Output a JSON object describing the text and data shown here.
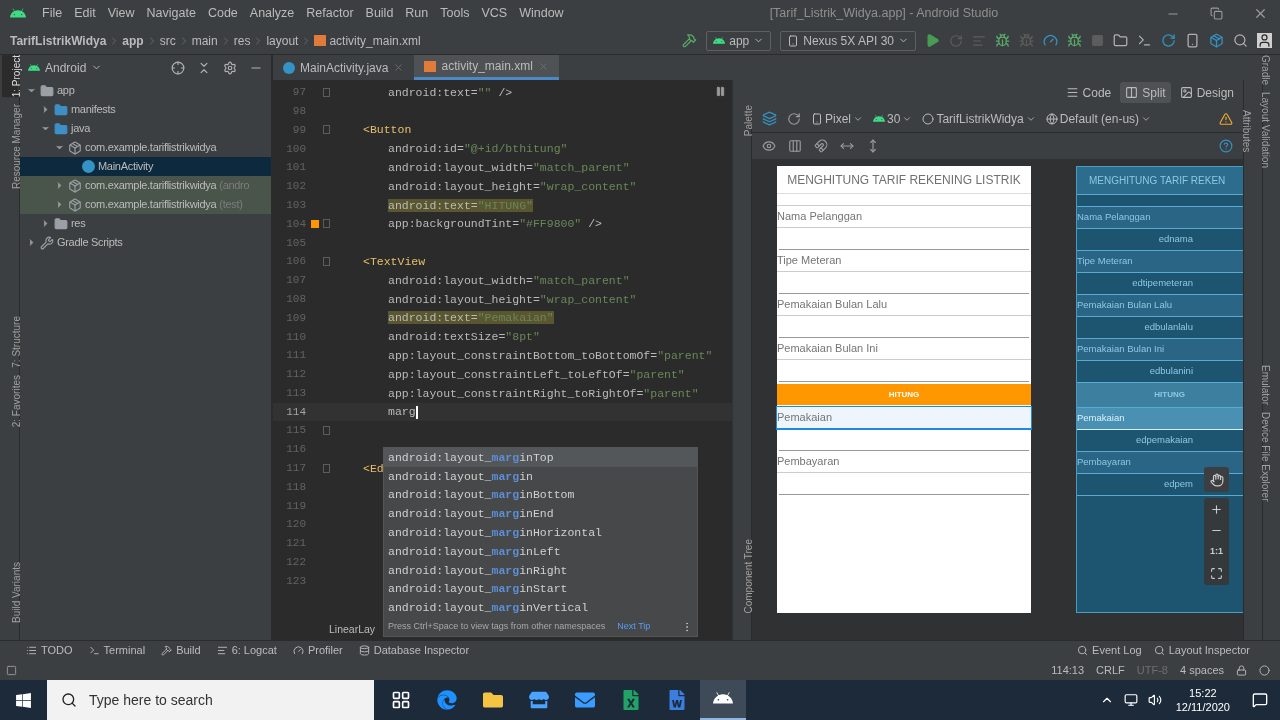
{
  "menu_bar": {
    "items": [
      "File",
      "Edit",
      "View",
      "Navigate",
      "Code",
      "Analyze",
      "Refactor",
      "Build",
      "Run",
      "Tools",
      "VCS",
      "Window"
    ],
    "title": "[Tarif_Listrik_Widya.app] - Android Studio"
  },
  "navigation_bar": {
    "breadcrumb": [
      "TarifListrikWidya",
      "app",
      "src",
      "main",
      "res",
      "layout",
      "activity_main.xml"
    ],
    "run_config": "app",
    "device": "Nexus 5X API 30"
  },
  "left_stripe": [
    {
      "label": "1: Project",
      "selected": true
    },
    {
      "label": "Resource Manager",
      "selected": false
    },
    {
      "label": "7: Structure",
      "selected": false
    },
    {
      "label": "2: Favorites",
      "selected": false
    },
    {
      "label": "Build Variants",
      "selected": false
    }
  ],
  "project_panel": {
    "view": "Android",
    "tree": [
      {
        "label": "app",
        "kind": "module",
        "expanded": true,
        "selected": false,
        "test": false,
        "children": [
          {
            "label": "manifests",
            "kind": "folder",
            "expanded": false,
            "selected": false,
            "test": false
          },
          {
            "label": "java",
            "kind": "folder",
            "expanded": true,
            "selected": false,
            "test": false,
            "children": [
              {
                "label": "com.example.tariflistrikwidya",
                "kind": "package",
                "expanded": true,
                "selected": false,
                "test": false,
                "children": [
                  {
                    "label": "MainActivity",
                    "kind": "class",
                    "expanded": false,
                    "selected": true,
                    "test": false
                  }
                ]
              },
              {
                "label": "com.example.tariflistrikwidya",
                "suffix": "(andro",
                "kind": "package",
                "expanded": false,
                "selected": false,
                "test": true
              },
              {
                "label": "com.example.tariflistrikwidya",
                "suffix": "(test)",
                "kind": "package",
                "expanded": false,
                "selected": false,
                "test": true
              }
            ]
          },
          {
            "label": "res",
            "kind": "resources",
            "expanded": false,
            "selected": false,
            "test": false
          }
        ]
      },
      {
        "label": "Gradle Scripts",
        "kind": "gradle",
        "expanded": false,
        "selected": false,
        "test": false
      }
    ]
  },
  "editor": {
    "tabs": [
      {
        "label": "MainActivity.java",
        "kind": "java",
        "selected": false
      },
      {
        "label": "activity_main.xml",
        "kind": "xml",
        "selected": true
      }
    ],
    "lines": [
      {
        "number": "97",
        "kind": "attr",
        "fold": true,
        "current": false,
        "highlighted": false,
        "segments": [
          {
            "text": "android:text=",
            "kind": "attr"
          },
          {
            "text": "\"\"",
            "kind": "value"
          },
          {
            "text": " />",
            "kind": "plain"
          }
        ]
      },
      {
        "number": "98",
        "kind": "blank",
        "fold": false,
        "current": false
      },
      {
        "number": "99",
        "kind": "tag",
        "fold": true,
        "current": false,
        "highlighted": false,
        "segments": [
          {
            "text": "<Button",
            "kind": "tag"
          }
        ]
      },
      {
        "number": "100",
        "kind": "attr",
        "fold": false,
        "current": false,
        "highlighted": false,
        "segments": [
          {
            "text": "android:id=",
            "kind": "attr"
          },
          {
            "text": "\"@+id/bthitung\"",
            "kind": "value"
          }
        ]
      },
      {
        "number": "101",
        "kind": "attr",
        "fold": false,
        "current": false,
        "highlighted": false,
        "segments": [
          {
            "text": "android:layout_width=",
            "kind": "attr"
          },
          {
            "text": "\"match_parent\"",
            "kind": "value"
          }
        ]
      },
      {
        "number": "102",
        "kind": "attr",
        "fold": false,
        "current": false,
        "highlighted": false,
        "segments": [
          {
            "text": "android:layout_height=",
            "kind": "attr"
          },
          {
            "text": "\"wrap_content\"",
            "kind": "value"
          }
        ]
      },
      {
        "number": "103",
        "kind": "attr",
        "fold": false,
        "current": false,
        "highlighted": true,
        "segments": [
          {
            "text": "android:text=",
            "kind": "attr"
          },
          {
            "text": "\"HITUNG\"",
            "kind": "value"
          }
        ]
      },
      {
        "number": "104",
        "kind": "attr",
        "fold": true,
        "current": false,
        "highlighted": false,
        "color": "#ff9800",
        "segments": [
          {
            "text": "app:backgroundTint=",
            "kind": "attr"
          },
          {
            "text": "\"#FF9800\"",
            "kind": "value"
          },
          {
            "text": " />",
            "kind": "plain"
          }
        ]
      },
      {
        "number": "105",
        "kind": "blank",
        "fold": false,
        "current": false
      },
      {
        "number": "106",
        "kind": "tag",
        "fold": true,
        "current": false,
        "highlighted": false,
        "segments": [
          {
            "text": "<TextView",
            "kind": "tag"
          }
        ]
      },
      {
        "number": "107",
        "kind": "attr",
        "fold": false,
        "current": false,
        "highlighted": false,
        "segments": [
          {
            "text": "android:layout_width=",
            "kind": "attr"
          },
          {
            "text": "\"match_parent\"",
            "kind": "value"
          }
        ]
      },
      {
        "number": "108",
        "kind": "attr",
        "fold": false,
        "current": false,
        "highlighted": false,
        "segments": [
          {
            "text": "android:layout_height=",
            "kind": "attr"
          },
          {
            "text": "\"wrap_content\"",
            "kind": "value"
          }
        ]
      },
      {
        "number": "109",
        "kind": "attr",
        "fold": false,
        "current": false,
        "highlighted": true,
        "segments": [
          {
            "text": "android:text=",
            "kind": "attr"
          },
          {
            "text": "\"Pemakaian\"",
            "kind": "value"
          }
        ]
      },
      {
        "number": "110",
        "kind": "attr",
        "fold": false,
        "current": false,
        "highlighted": false,
        "segments": [
          {
            "text": "android:textSize=",
            "kind": "attr"
          },
          {
            "text": "\"8pt\"",
            "kind": "value"
          }
        ]
      },
      {
        "number": "111",
        "kind": "attr",
        "fold": false,
        "current": false,
        "highlighted": false,
        "segments": [
          {
            "text": "app:layout_constraintBottom_toBottomOf=",
            "kind": "attr"
          },
          {
            "text": "\"parent\"",
            "kind": "value"
          }
        ]
      },
      {
        "number": "112",
        "kind": "attr",
        "fold": false,
        "current": false,
        "highlighted": false,
        "segments": [
          {
            "text": "app:layout_constraintLeft_toLeftOf=",
            "kind": "attr"
          },
          {
            "text": "\"parent\"",
            "kind": "value"
          }
        ]
      },
      {
        "number": "113",
        "kind": "attr",
        "fold": false,
        "current": false,
        "highlighted": false,
        "segments": [
          {
            "text": "app:layout_constraintRight_toRightOf=",
            "kind": "attr"
          },
          {
            "text": "\"parent\"",
            "kind": "value"
          }
        ]
      },
      {
        "number": "114",
        "kind": "attr",
        "fold": false,
        "current": true,
        "highlighted": false,
        "segments": [
          {
            "text": "marg",
            "kind": "plain"
          }
        ]
      },
      {
        "number": "115",
        "kind": "blank",
        "fold": true,
        "current": false
      },
      {
        "number": "116",
        "kind": "blank",
        "fold": false,
        "current": false
      },
      {
        "number": "117",
        "kind": "tag",
        "fold": true,
        "current": false,
        "highlighted": false,
        "segments": [
          {
            "text": "<Ed",
            "kind": "tag"
          }
        ]
      },
      {
        "number": "118",
        "kind": "blank",
        "fold": false,
        "current": false
      },
      {
        "number": "119",
        "kind": "blank",
        "fold": false,
        "current": false
      },
      {
        "number": "120",
        "kind": "blank",
        "fold": false,
        "current": false
      },
      {
        "number": "121",
        "kind": "blank",
        "fold": false,
        "current": false
      },
      {
        "number": "122",
        "kind": "blank",
        "fold": false,
        "current": false
      },
      {
        "number": "123",
        "kind": "blank",
        "fold": false,
        "current": false
      }
    ],
    "completion": {
      "items": [
        {
          "before": "android:layout_",
          "match": "marg",
          "after": "inTop",
          "selected": true
        },
        {
          "before": "android:layout_",
          "match": "marg",
          "after": "in",
          "selected": false
        },
        {
          "before": "android:layout_",
          "match": "marg",
          "after": "inBottom",
          "selected": false
        },
        {
          "before": "android:layout_",
          "match": "marg",
          "after": "inEnd",
          "selected": false
        },
        {
          "before": "android:layout_",
          "match": "marg",
          "after": "inHorizontal",
          "selected": false
        },
        {
          "before": "android:layout_",
          "match": "marg",
          "after": "inLeft",
          "selected": false
        },
        {
          "before": "android:layout_",
          "match": "marg",
          "after": "inRight",
          "selected": false
        },
        {
          "before": "android:layout_",
          "match": "marg",
          "after": "inStart",
          "selected": false
        },
        {
          "before": "android:layout_",
          "match": "marg",
          "after": "inVertical",
          "selected": false
        }
      ],
      "hint": "Press Ctrl+Space to view tags from other namespaces",
      "hint_link": "Next Tip"
    },
    "breadcrumb": "LinearLay"
  },
  "design": {
    "view_modes": [
      {
        "label": "Code",
        "kind": "code",
        "selected": false
      },
      {
        "label": "Split",
        "kind": "split",
        "selected": true
      },
      {
        "label": "Design",
        "kind": "design",
        "selected": false
      }
    ],
    "toolbar": {
      "device": "Pixel",
      "api": "30",
      "theme": "TarifListrikWidya",
      "locale": "Default (en-us)"
    },
    "side_tabs": [
      "Palette",
      "Component Tree"
    ],
    "preview": {
      "title": "MENGHITUNG TARIF REKENING LISTRIK",
      "rows": [
        {
          "kind": "input",
          "label": "Nama Pelanggan",
          "selected": false
        },
        {
          "kind": "input",
          "label": "Tipe Meteran",
          "selected": false
        },
        {
          "kind": "input",
          "label": "Pemakaian Bulan Lalu",
          "selected": false
        },
        {
          "kind": "input",
          "label": "Pemakaian Bulan Ini",
          "selected": false
        },
        {
          "kind": "button",
          "label": "HITUNG",
          "selected": false
        },
        {
          "kind": "input",
          "label": "Pemakaian",
          "selected": true
        },
        {
          "kind": "input",
          "label": "Pembayaran",
          "selected": false
        }
      ]
    },
    "blueprint": {
      "title": "MENGHITUNG TARIF REKEN",
      "rows": [
        {
          "kind": "input",
          "label": "Nama Pelanggan",
          "id": "ednama",
          "selected": false
        },
        {
          "kind": "input",
          "label": "Tipe Meteran",
          "id": "edtipemeteran",
          "selected": false
        },
        {
          "kind": "input",
          "label": "Pemakaian Bulan Lalu",
          "id": "edbulanlalu",
          "selected": false
        },
        {
          "kind": "input",
          "label": "Pemakaian Bulan Ini",
          "id": "edbulanini",
          "selected": false
        },
        {
          "kind": "button",
          "label": "HITUNG",
          "selected": false
        },
        {
          "kind": "input",
          "label": "Pemakaian",
          "id": "edpemakaian",
          "selected": true
        },
        {
          "kind": "input",
          "label": "Pembayaran",
          "id": "edpem",
          "selected": false
        }
      ]
    },
    "zoom_ratio": "1:1",
    "attributes_tab": "Attributes"
  },
  "right_stripe": [
    "Gradle",
    "Layout Validation",
    "Emulator",
    "Device File Explorer"
  ],
  "tool_windows": {
    "left": [
      "TODO",
      "Terminal",
      "Build",
      "6: Logcat",
      "Profiler",
      "Database Inspector"
    ],
    "right": [
      "Event Log",
      "Layout Inspector"
    ]
  },
  "status_bar": [
    {
      "text": "114:13",
      "disabled": false
    },
    {
      "text": "CRLF",
      "disabled": false
    },
    {
      "text": "UTF-8",
      "disabled": true
    },
    {
      "text": "4 spaces",
      "disabled": false
    }
  ],
  "taskbar": {
    "search_placeholder": "Type here to search",
    "apps": [
      {
        "kind": "task_view",
        "active": false
      },
      {
        "kind": "edge",
        "active": false
      },
      {
        "kind": "explorer",
        "active": false
      },
      {
        "kind": "store",
        "active": false
      },
      {
        "kind": "mail",
        "active": false
      },
      {
        "kind": "excel",
        "active": false
      },
      {
        "kind": "word",
        "active": false
      },
      {
        "kind": "android_studio",
        "active": true
      }
    ],
    "time": "15:22",
    "date": "12/11/2020"
  }
}
